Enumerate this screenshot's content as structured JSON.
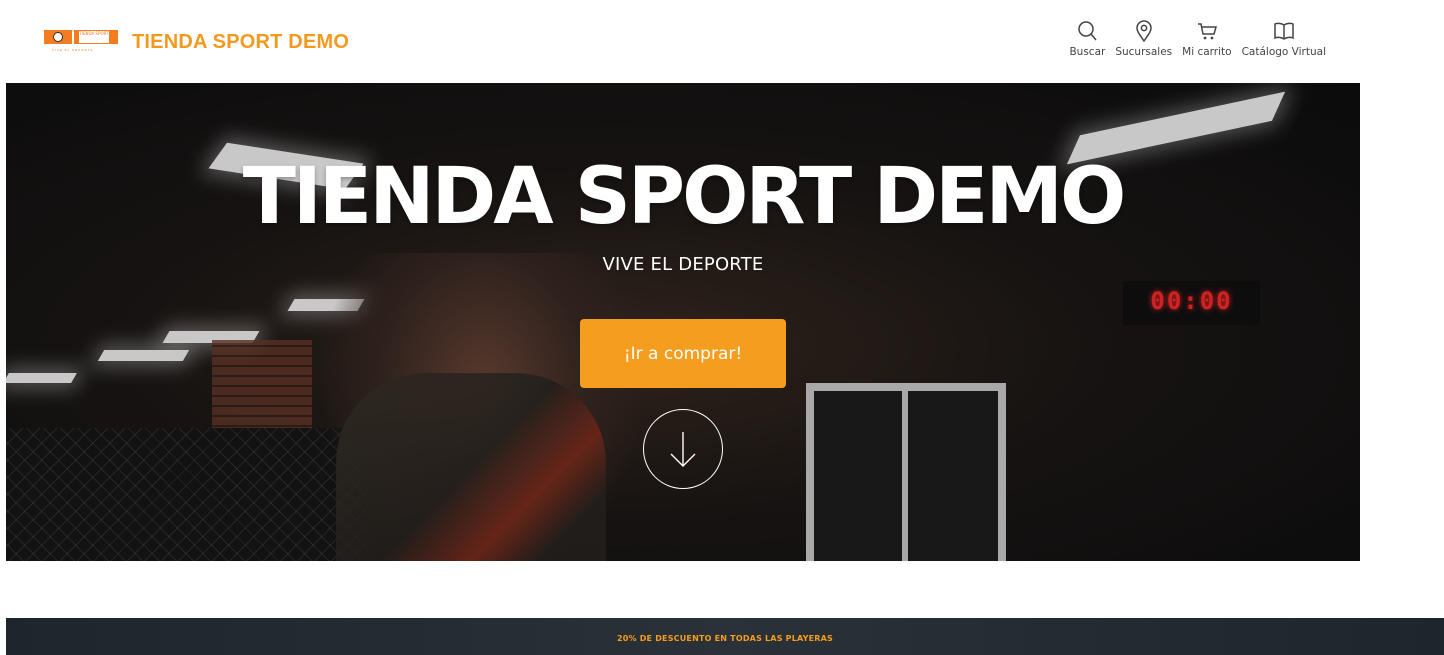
{
  "header": {
    "brand_name": "TIENDA SPORT DEMO",
    "logo_text": "TIENDA SPORT",
    "logo_tagline": "VIVE EL DEPORTE",
    "nav": [
      {
        "label": "Buscar",
        "icon": "search-icon"
      },
      {
        "label": "Sucursales",
        "icon": "location-pin-icon"
      },
      {
        "label": "Mi carrito",
        "icon": "cart-icon"
      },
      {
        "label": "Catálogo Virtual",
        "icon": "book-icon"
      }
    ]
  },
  "hero": {
    "title": "TIENDA SPORT DEMO",
    "subtitle": "VIVE EL DEPORTE",
    "cta_label": "¡Ir a comprar!",
    "clock": "00:00"
  },
  "promo": {
    "text": "20% DE DESCUENTO EN TODAS LAS PLAYERAS"
  },
  "colors": {
    "brand_orange": "#f39a1e",
    "cta_orange": "#f59d1e",
    "promo_bg": "#1d262d"
  }
}
